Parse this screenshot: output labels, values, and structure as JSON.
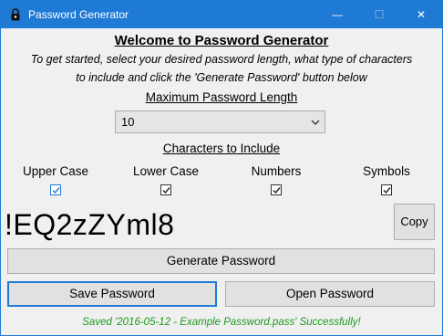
{
  "window": {
    "title": "Password Generator",
    "title_bar_color": "#1f7ad6",
    "controls": {
      "minimize": "—",
      "maximize": "☐",
      "close": "✕"
    }
  },
  "header": {
    "title": "Welcome to Password Generator",
    "intro_line1": "To get started, select your desired password length, what type of characters",
    "intro_line2": "to include and click the 'Generate Password' button below"
  },
  "length": {
    "label": "Maximum Password Length",
    "selected": "10"
  },
  "characters": {
    "label": "Characters to Include",
    "options": [
      {
        "label": "Upper Case",
        "checked": true
      },
      {
        "label": "Lower Case",
        "checked": true
      },
      {
        "label": "Numbers",
        "checked": true
      },
      {
        "label": "Symbols",
        "checked": true
      }
    ]
  },
  "output": {
    "password": "!EQ2zZYml8",
    "copy_label": "Copy"
  },
  "actions": {
    "generate_label": "Generate Password",
    "save_label": "Save Password",
    "open_label": "Open Password"
  },
  "status": {
    "message": "Saved '2016-05-12 - Example Password.pass' Successfully!",
    "color": "#1c9a1c"
  },
  "icons": {
    "app": "lock-icon",
    "dropdown": "chevron-down-icon",
    "check": "check-icon"
  }
}
